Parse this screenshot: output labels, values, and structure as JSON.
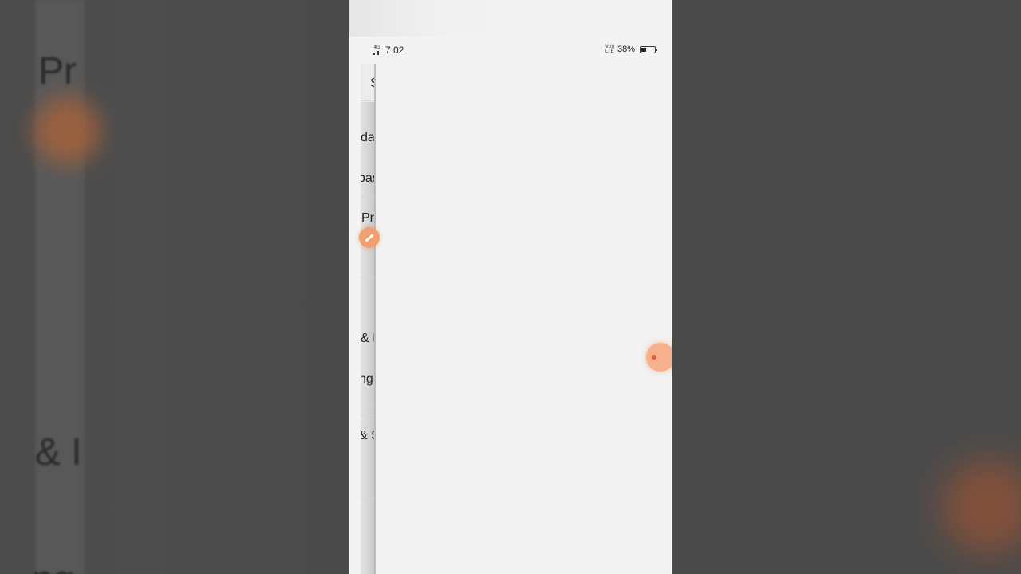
{
  "status_bar": {
    "network_label": "4G",
    "time": "7:02",
    "volte_top": "Vo))",
    "volte_bottom": "LTE",
    "battery_percent": "38%",
    "battery_level": 0.38
  },
  "drawer": {
    "items": [
      {
        "label": "S"
      },
      {
        "label": "da"
      },
      {
        "label": "bas"
      },
      {
        "label": "Pr"
      },
      {
        "label": "& I"
      },
      {
        "label": "ng"
      },
      {
        "label": "& S"
      }
    ]
  },
  "background": {
    "left_text_1": "Pr",
    "left_text_2": "& I",
    "left_text_3": "ng"
  },
  "colors": {
    "accent": "#f0a070",
    "bubble_dot": "#e05a48"
  }
}
